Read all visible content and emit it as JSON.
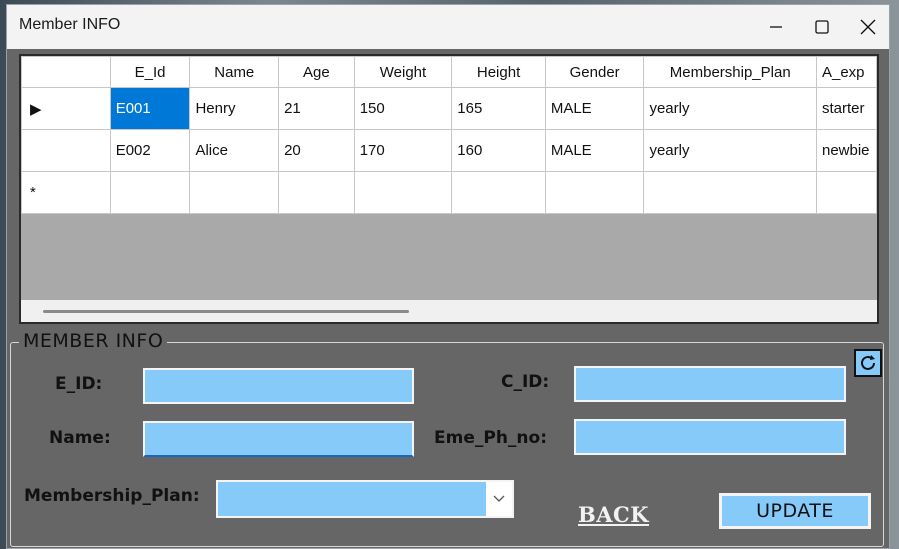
{
  "window": {
    "title": "Member INFO",
    "minimize_icon": "minimize-icon",
    "maximize_icon": "maximize-icon",
    "close_icon": "close-icon"
  },
  "grid": {
    "columns": [
      "",
      "E_Id",
      "Name",
      "Age",
      "Weight",
      "Height",
      "Gender",
      "Membership_Plan",
      "A_exp"
    ],
    "rows": [
      {
        "indicator": "▶",
        "cells": [
          "E001",
          "Henry",
          "21",
          "150",
          "165",
          "MALE",
          "yearly",
          "starter"
        ]
      },
      {
        "indicator": "",
        "cells": [
          "E002",
          "Alice",
          "20",
          "170",
          "160",
          "MALE",
          "yearly",
          "newbie"
        ]
      },
      {
        "indicator": "*",
        "cells": [
          "",
          "",
          "",
          "",
          "",
          "",
          "",
          ""
        ]
      }
    ]
  },
  "form": {
    "group_title": "MEMBER INFO",
    "e_id_label": "E_ID:",
    "c_id_label": "C_ID:",
    "name_label": "Name:",
    "eme_label": "Eme_Ph_no:",
    "plan_label": "Membership_Plan:",
    "e_id_value": "",
    "c_id_value": "",
    "name_value": "",
    "eme_value": "",
    "plan_value": "",
    "back_label": "BACK",
    "update_label": "UPDATE",
    "refresh_icon": "refresh-icon"
  },
  "colors": {
    "field_bg": "#85caf8",
    "selection": "#0078d7",
    "panel_bg": "#666666"
  }
}
